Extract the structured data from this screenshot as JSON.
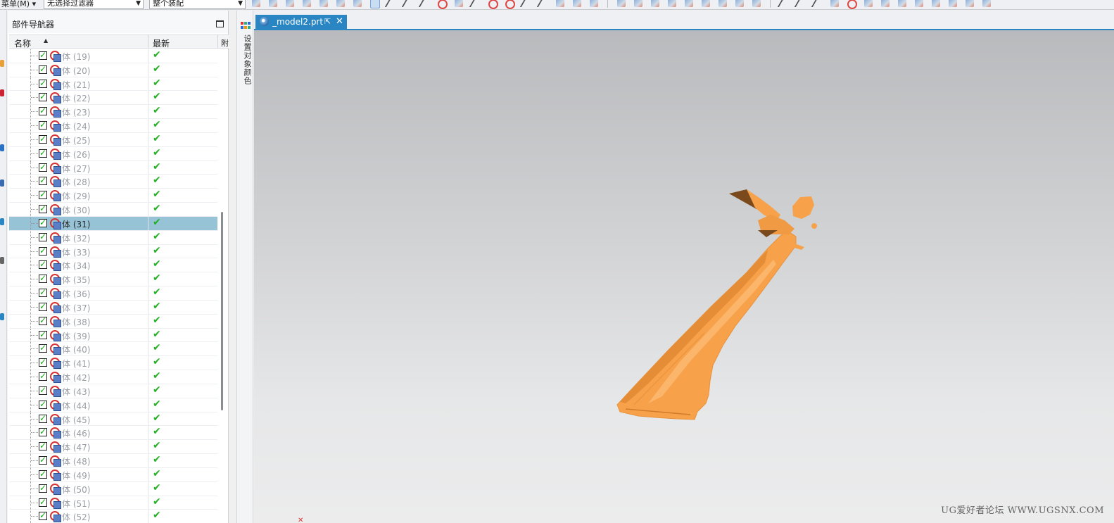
{
  "toolbar": {
    "menu_label": "菜单(M) ▾",
    "selection_filter": "无选择过滤器",
    "assembly_scope": "整个装配"
  },
  "navigator": {
    "title": "部件导航器",
    "columns": {
      "name": "名称",
      "latest": "最新",
      "attached": "附"
    },
    "rows": [
      {
        "name": "体 (19)",
        "latest": "✔",
        "selected": false
      },
      {
        "name": "体 (20)",
        "latest": "✔",
        "selected": false
      },
      {
        "name": "体 (21)",
        "latest": "✔",
        "selected": false
      },
      {
        "name": "体 (22)",
        "latest": "✔",
        "selected": false
      },
      {
        "name": "体 (23)",
        "latest": "✔",
        "selected": false
      },
      {
        "name": "体 (24)",
        "latest": "✔",
        "selected": false
      },
      {
        "name": "体 (25)",
        "latest": "✔",
        "selected": false
      },
      {
        "name": "体 (26)",
        "latest": "✔",
        "selected": false
      },
      {
        "name": "体 (27)",
        "latest": "✔",
        "selected": false
      },
      {
        "name": "体 (28)",
        "latest": "✔",
        "selected": false
      },
      {
        "name": "体 (29)",
        "latest": "✔",
        "selected": false
      },
      {
        "name": "体 (30)",
        "latest": "✔",
        "selected": false
      },
      {
        "name": "体 (31)",
        "latest": "✔",
        "selected": true
      },
      {
        "name": "体 (32)",
        "latest": "✔",
        "selected": false
      },
      {
        "name": "体 (33)",
        "latest": "✔",
        "selected": false
      },
      {
        "name": "体 (34)",
        "latest": "✔",
        "selected": false
      },
      {
        "name": "体 (35)",
        "latest": "✔",
        "selected": false
      },
      {
        "name": "体 (36)",
        "latest": "✔",
        "selected": false
      },
      {
        "name": "体 (37)",
        "latest": "✔",
        "selected": false
      },
      {
        "name": "体 (38)",
        "latest": "✔",
        "selected": false
      },
      {
        "name": "体 (39)",
        "latest": "✔",
        "selected": false
      },
      {
        "name": "体 (40)",
        "latest": "✔",
        "selected": false
      },
      {
        "name": "体 (41)",
        "latest": "✔",
        "selected": false
      },
      {
        "name": "体 (42)",
        "latest": "✔",
        "selected": false
      },
      {
        "name": "体 (43)",
        "latest": "✔",
        "selected": false
      },
      {
        "name": "体 (44)",
        "latest": "✔",
        "selected": false
      },
      {
        "name": "体 (45)",
        "latest": "✔",
        "selected": false
      },
      {
        "name": "体 (46)",
        "latest": "✔",
        "selected": false
      },
      {
        "name": "体 (47)",
        "latest": "✔",
        "selected": false
      },
      {
        "name": "体 (48)",
        "latest": "✔",
        "selected": false
      },
      {
        "name": "体 (49)",
        "latest": "✔",
        "selected": false
      },
      {
        "name": "体 (50)",
        "latest": "✔",
        "selected": false
      },
      {
        "name": "体 (51)",
        "latest": "✔",
        "selected": false
      },
      {
        "name": "体 (52)",
        "latest": "✔",
        "selected": false
      }
    ]
  },
  "resource_bar": {
    "label": "设置对象颜色"
  },
  "tab": {
    "label": "_model2.prt",
    "close": "✕",
    "ext": "⇱"
  },
  "viewport": {
    "watermark": "UG爱好者论坛 WWW.UGSNX.COM",
    "origin": "✕",
    "model_color": "#f7a24a"
  },
  "colors": {
    "accent": "#2a86c3",
    "selected_row": "#96c3d6",
    "check_green": "#22b122"
  }
}
